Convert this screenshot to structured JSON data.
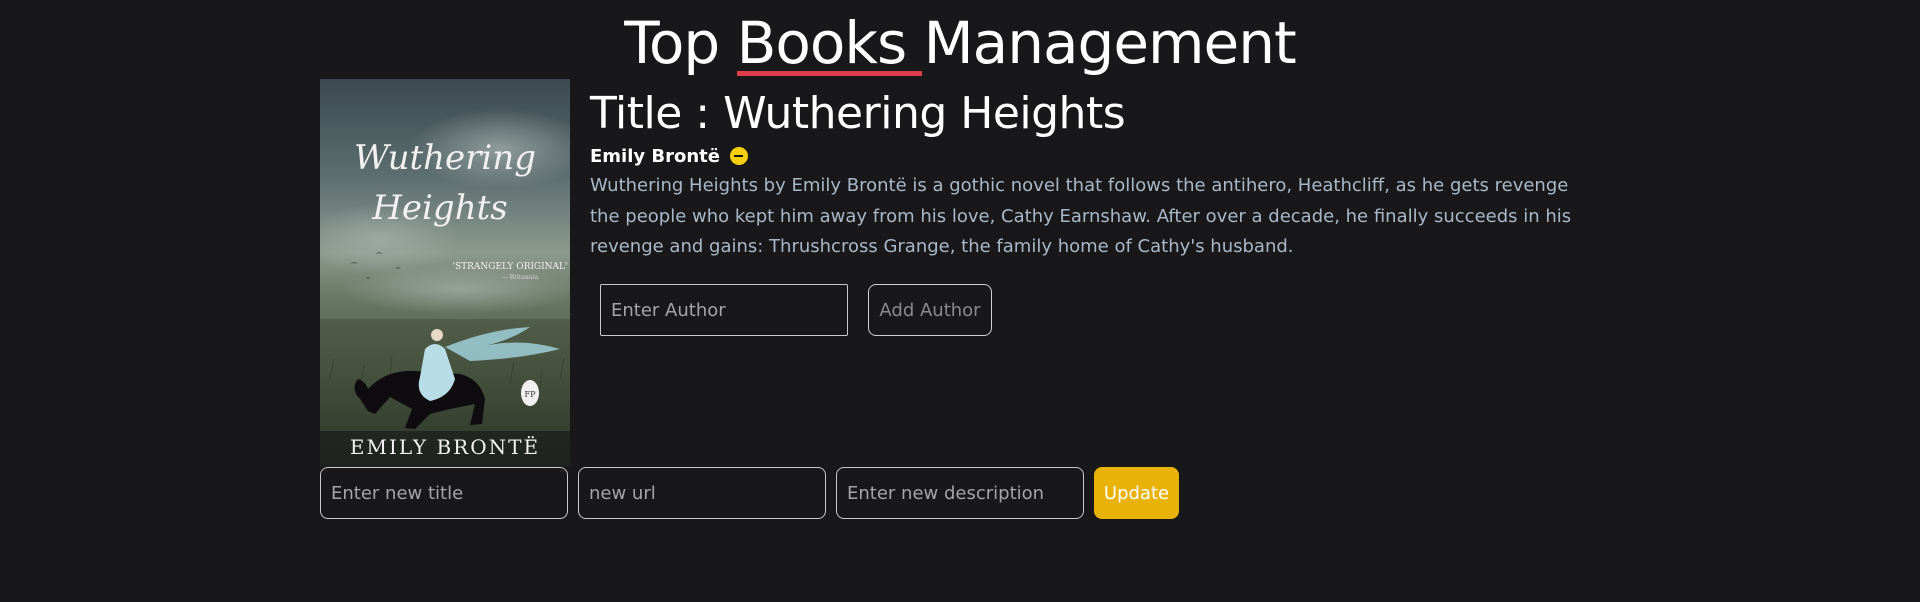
{
  "header": {
    "title_start": "Top ",
    "title_highlight": "Books",
    "title_end": " Management",
    "underline_color": "#e03e4a"
  },
  "book": {
    "title": "Title : Wuthering Heights",
    "author": "Emily Brontë",
    "remove_author_icon": "minus-circle-icon",
    "description": "Wuthering Heights by Emily Brontë is a gothic novel that follows the antihero, Heathcliff, as he gets revenge the people who kept him away from his love, Cathy Earnshaw. After over a decade, he finally succeeds in his revenge and gains: Thrushcross Grange, the family home of Cathy's husband.",
    "cover": {
      "title_line1": "Wuthering",
      "title_line2": "Heights",
      "tagline": "'STRANGELY ORIGINAL'",
      "tagline_source": "— Britannia",
      "author": "EMILY BRONTË",
      "publisher_mark": "FP"
    }
  },
  "add_author": {
    "input_placeholder": "Enter Author",
    "button_label": "Add Author"
  },
  "edit_form": {
    "title_placeholder": "Enter new title",
    "url_placeholder": "new url",
    "description_placeholder": "Enter new description",
    "update_label": "Update"
  },
  "colors": {
    "background": "#18181a",
    "accent_yellow": "#e9b208",
    "description_text": "#a9b8c8"
  }
}
